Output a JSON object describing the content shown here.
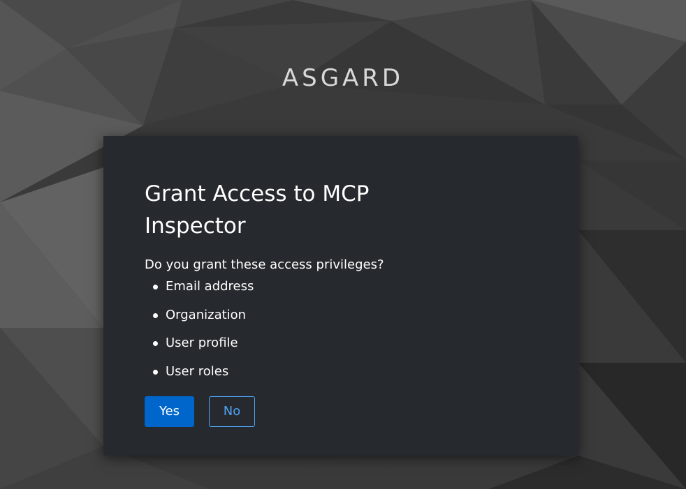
{
  "realm": {
    "title": "ASGARD"
  },
  "consent": {
    "title": "Grant Access to MCP Inspector",
    "question": "Do you grant these access privileges?",
    "scopes": [
      {
        "label": "Email address"
      },
      {
        "label": "Organization"
      },
      {
        "label": "User profile"
      },
      {
        "label": "User roles"
      }
    ],
    "yes_label": "Yes",
    "no_label": "No"
  },
  "colors": {
    "background": "#3a3a3a",
    "card": "#26292d",
    "primary": "#0066cc",
    "link": "#4ea3f5"
  }
}
